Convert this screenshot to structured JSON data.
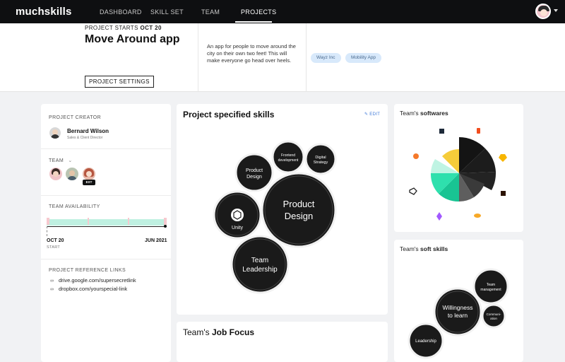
{
  "nav": {
    "logo": "muchskills",
    "links": [
      "DASHBOARD",
      "SKILL SET",
      "TEAM",
      "PROJECTS"
    ],
    "active": "PROJECTS"
  },
  "header": {
    "starts_prefix": "PROJECT STARTS",
    "starts_date": "OCT 20",
    "title": "Move Around app",
    "settings_button": "PROJECT SETTINGS",
    "description": "An app for people to move around the city on their own two feet! This will make everyone go head over heels.",
    "tags": [
      "Wayz Inc",
      "Mobility App"
    ]
  },
  "left_panel": {
    "creator_label": "PROJECT CREATOR",
    "creator_name": "Bernard Wilson",
    "creator_role": "Sales & Client Director",
    "team_label": "TEAM",
    "ext_badge": "EXT",
    "availability_label": "TEAM AVAILABILITY",
    "date_start": "OCT 20",
    "date_start_sub": "START",
    "date_end": "JUN 2021",
    "links_label": "PROJECT REFERENCE LINKS",
    "links": [
      "drive.google.com/supersecretlink",
      "dropbox.com/yourspecial-link"
    ]
  },
  "skills_card": {
    "title": "Project specified skills",
    "edit": "EDIT",
    "bubbles": [
      "Product Design",
      "Team Leadership",
      "Unity",
      "Product Design",
      "Frontend development",
      "Digital Strategy"
    ]
  },
  "job_focus": {
    "prefix": "Team's",
    "bold": "Job Focus"
  },
  "softwares": {
    "prefix": "Team's",
    "bold": "softwares"
  },
  "soft_skills": {
    "prefix": "Team's",
    "bold": "soft skills",
    "bubbles": [
      "Willingness to learn",
      "Team management",
      "Leadership",
      "Communi-ation"
    ]
  },
  "colors": {
    "nav_bg": "#0e0f11",
    "tag_bg": "#d8e9fb",
    "accent_teal": "#1fcf9a",
    "accent_yellow": "#f5cc3a",
    "bubble": "#1a1a1a",
    "avail_bar": "#bff0e1"
  }
}
